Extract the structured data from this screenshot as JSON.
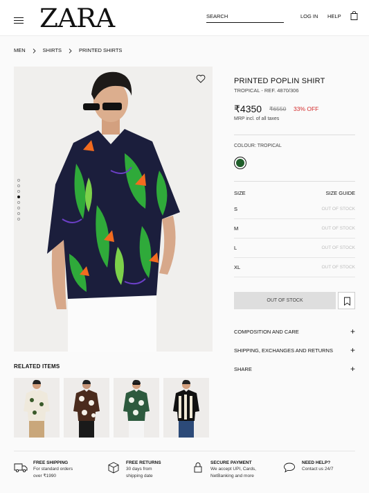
{
  "header": {
    "brand": "ZARA",
    "search_label": "SEARCH",
    "login_label": "LOG IN",
    "help_label": "HELP"
  },
  "breadcrumb": [
    "MEN",
    "SHIRTS",
    "PRINTED SHIRTS"
  ],
  "product": {
    "name": "PRINTED POPLIN SHIRT",
    "ref": "TROPICAL - REF. 4870/306",
    "price": "₹4350",
    "old_price": "₹6550",
    "discount": "33% OFF",
    "tax_note": "MRP incl. of all taxes",
    "colour_label": "COLOUR: TROPICAL",
    "gallery_index": 4,
    "gallery_count": 8
  },
  "sizes": {
    "label": "SIZE",
    "guide": "SIZE GUIDE",
    "items": [
      {
        "size": "S",
        "status": "OUT OF STOCK"
      },
      {
        "size": "M",
        "status": "OUT OF STOCK"
      },
      {
        "size": "L",
        "status": "OUT OF STOCK"
      },
      {
        "size": "XL",
        "status": "OUT OF STOCK"
      }
    ]
  },
  "actions": {
    "out_of_stock": "OUT OF STOCK"
  },
  "accordion": [
    {
      "label": "COMPOSITION AND CARE"
    },
    {
      "label": "SHIPPING, EXCHANGES AND RETURNS"
    },
    {
      "label": "SHARE"
    }
  ],
  "related": {
    "title": "RELATED ITEMS"
  },
  "features": [
    {
      "icon": "truck-icon",
      "title": "FREE SHIPPING",
      "line1": "For standard orders",
      "line2": "over ₹1990"
    },
    {
      "icon": "box-icon",
      "title": "FREE RETURNS",
      "line1": "30 days from",
      "line2": "shipping date"
    },
    {
      "icon": "lock-icon",
      "title": "SECURE PAYMENT",
      "line1": "We accept UPI, Cards,",
      "line2": "NetBanking and more"
    },
    {
      "icon": "chat-icon",
      "title": "NEED HELP?",
      "line1": "Contact us 24/7",
      "line2": ""
    }
  ],
  "colors": {
    "accent_red": "#d32a2a",
    "disabled_button": "#dedede"
  }
}
